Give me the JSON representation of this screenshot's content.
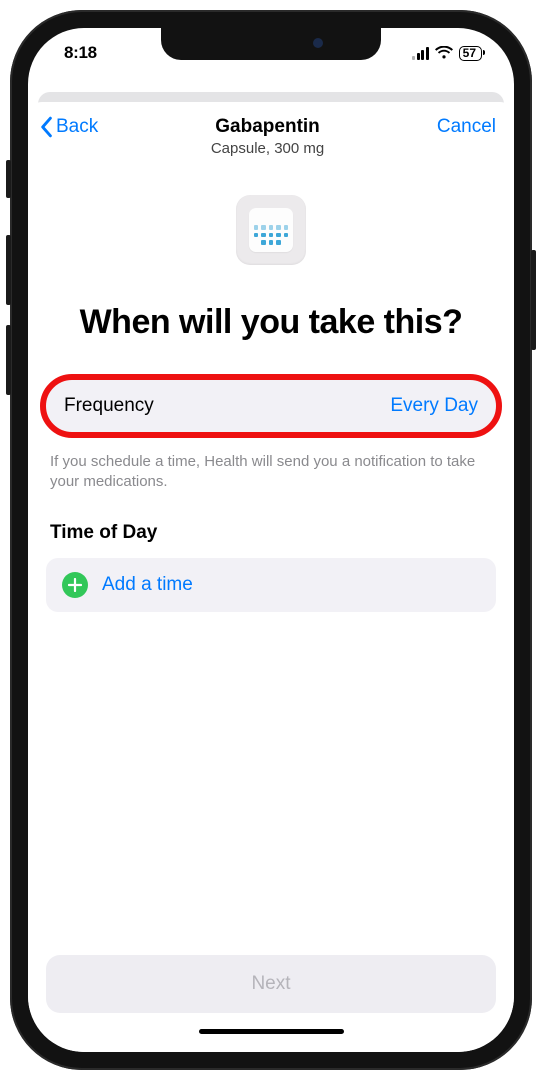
{
  "status": {
    "time": "8:18",
    "battery": "57"
  },
  "nav": {
    "back": "Back",
    "title": "Gabapentin",
    "subtitle": "Capsule, 300 mg",
    "cancel": "Cancel"
  },
  "heading": "When will you take this?",
  "frequency": {
    "label": "Frequency",
    "value": "Every Day"
  },
  "hint": "If you schedule a time, Health will send you a notification to take your medications.",
  "timeSection": {
    "title": "Time of Day",
    "addLabel": "Add a time"
  },
  "next": "Next"
}
